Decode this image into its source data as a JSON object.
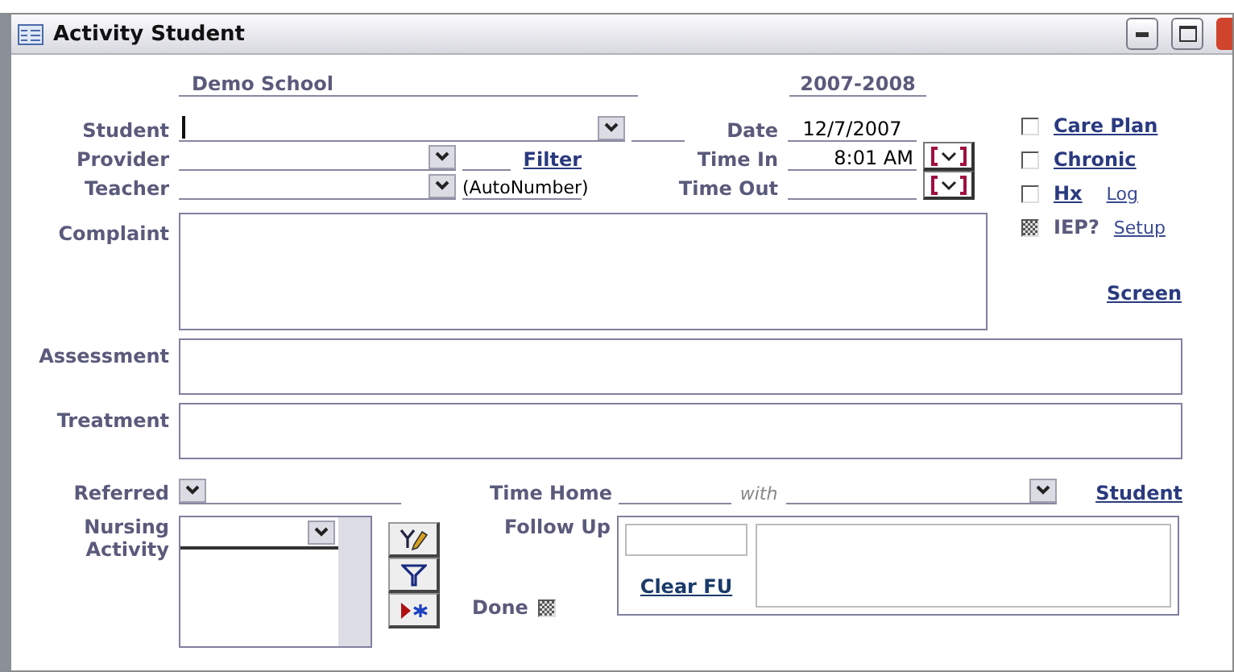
{
  "window": {
    "title": "Activity Student"
  },
  "header": {
    "school": "Demo School",
    "year": "2007-2008"
  },
  "fields": {
    "student": {
      "label": "Student"
    },
    "provider": {
      "label": "Provider"
    },
    "teacher": {
      "label": "Teacher"
    },
    "autonumber": "(AutoNumber)",
    "filter_link": "Filter",
    "date": {
      "label": "Date",
      "value": "12/7/2007"
    },
    "time_in": {
      "label": "Time In",
      "value": "8:01 AM"
    },
    "time_out": {
      "label": "Time Out"
    }
  },
  "checks": [
    {
      "label": "Care Plan",
      "checked": false,
      "kind": "link"
    },
    {
      "label": "Chronic",
      "checked": false,
      "kind": "link"
    },
    {
      "label": "Hx",
      "checked": false,
      "kind": "link",
      "extra_link": "Log"
    },
    {
      "label": "IEP?",
      "checked": true,
      "kind": "label",
      "extra_link": "Setup"
    }
  ],
  "screen_link": "Screen",
  "complaint_label": "Complaint",
  "assessment_label": "Assessment",
  "treatment_label": "Treatment",
  "referred": {
    "label": "Referred",
    "time_home_label": "Time Home",
    "with_label": "with",
    "student_link": "Student"
  },
  "nursing": {
    "label": "Nursing Activity",
    "follow_up_label": "Follow Up",
    "clear_link": "Clear FU",
    "done": {
      "label": "Done",
      "checked": true
    }
  }
}
